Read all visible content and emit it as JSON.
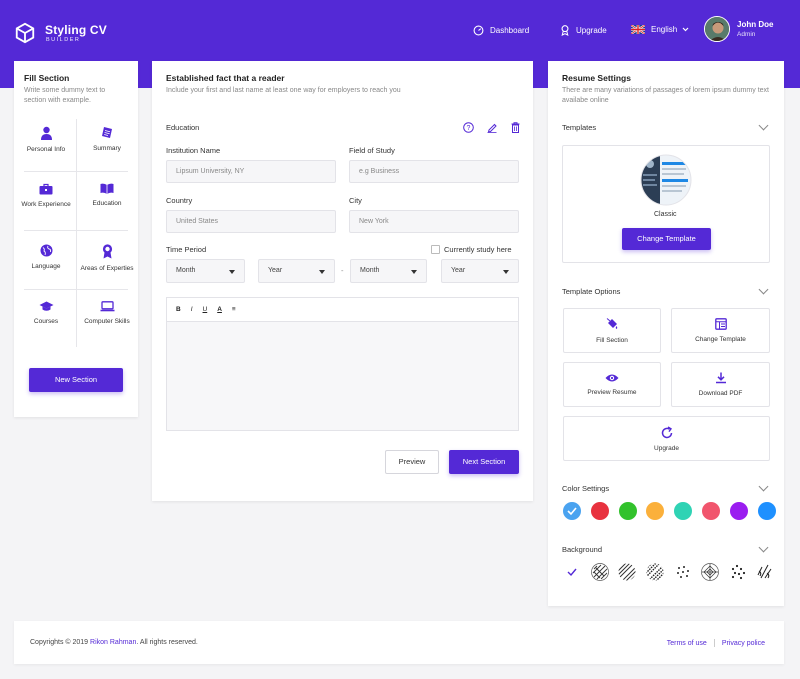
{
  "brand": {
    "title": "Styling CV",
    "subtitle": "BUILDER"
  },
  "nav": {
    "dashboard": "Dashboard",
    "upgrade": "Upgrade",
    "language": "English"
  },
  "user": {
    "name": "John Doe",
    "role": "Admin"
  },
  "left": {
    "title": "Fill Section",
    "subtitle": "Write some dummy text to section with example.",
    "items": [
      {
        "label": "Personal Info",
        "icon": "user-icon"
      },
      {
        "label": "Summary",
        "icon": "document-icon"
      },
      {
        "label": "Work Experience",
        "icon": "briefcase-icon"
      },
      {
        "label": "Education",
        "icon": "book-icon"
      },
      {
        "label": "Language",
        "icon": "globe-icon"
      },
      {
        "label": "Areas of Experties",
        "icon": "award-icon"
      },
      {
        "label": "Courses",
        "icon": "graduation-cap-icon"
      },
      {
        "label": "Computer Skills",
        "icon": "laptop-icon"
      }
    ],
    "new_section": "New Section"
  },
  "mid": {
    "title": "Established fact that a reader",
    "subtitle": "Include your first and last name at least one way for employers to reach you",
    "section": "Education",
    "institution_label": "Institution Name",
    "institution_placeholder": "Lipsum University, NY",
    "field_label": "Field of Study",
    "field_placeholder": "e.g Business",
    "country_label": "Country",
    "country_placeholder": "United States",
    "city_label": "City",
    "city_placeholder": "New York",
    "time_label": "Time Period",
    "currently": "Currently study here",
    "month1": "Month",
    "year1": "Year",
    "dash": "-",
    "month2": "Month",
    "year2": "Year",
    "toolbar": [
      "B",
      "I",
      "U",
      "A",
      "≡"
    ],
    "preview": "Preview",
    "next": "Next Section"
  },
  "right": {
    "title": "Resume Settings",
    "subtitle": "There are many variations of passages of lorem ipsum dummy text availabe online",
    "templates": "Templates",
    "template_name": "Classic",
    "change_template_btn": "Change Template",
    "template_options": "Template Options",
    "options": {
      "fill": "Fill Section",
      "change": "Change Template",
      "preview": "Preview Resume",
      "download": "Download PDF",
      "upgrade": "Upgrade"
    },
    "color_settings": "Color Settings",
    "colors": [
      "#4aa3f0",
      "#e8323f",
      "#32c22c",
      "#fbb03b",
      "#2fd3b4",
      "#f1556d",
      "#9a1df0",
      "#1e90ff"
    ],
    "background": "Background"
  },
  "footer": {
    "copy_prefix": "Copyrights © 2019 ",
    "author": "Rikon Rahman",
    "copy_suffix": ". All rights reserved.",
    "terms": "Terms of use",
    "privacy": "Privacy police"
  }
}
